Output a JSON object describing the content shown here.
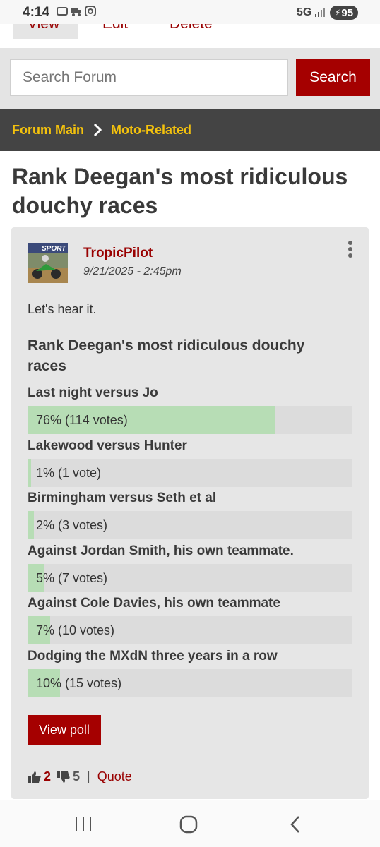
{
  "status_bar": {
    "time": "4:14",
    "network": "5G",
    "battery": "95"
  },
  "post_tabs": {
    "view": "View",
    "edit": "Edit",
    "delete": "Delete"
  },
  "search": {
    "placeholder": "Search Forum",
    "button_label": "Search"
  },
  "breadcrumb": {
    "items": [
      "Forum Main",
      "Moto-Related"
    ]
  },
  "thread": {
    "title": "Rank Deegan's most ridiculous douchy races"
  },
  "post": {
    "author": "TropicPilot",
    "date": "9/21/2025 - 2:45pm",
    "body": "Let's hear it.",
    "avatar_text": "SPORT",
    "likes": "2",
    "dislikes": "5",
    "divider": "|",
    "quote_label": "Quote"
  },
  "poll": {
    "question": "Rank Deegan's most ridiculous douchy races",
    "options": [
      {
        "label": "Last night versus Jo",
        "result": "76% (114 votes)",
        "percent": 76
      },
      {
        "label": "Lakewood versus Hunter",
        "result": "1% (1 vote)",
        "percent": 1
      },
      {
        "label": "Birmingham versus Seth et al",
        "result": "2% (3 votes)",
        "percent": 2
      },
      {
        "label": "Against Jordan Smith, his own teammate.",
        "result": "5% (7 votes)",
        "percent": 5
      },
      {
        "label": "Against Cole Davies, his own teammate",
        "result": "7% (10 votes)",
        "percent": 7
      },
      {
        "label": "Dodging the MXdN three years in a row",
        "result": "10% (15 votes)",
        "percent": 10
      }
    ],
    "view_poll_label": "View poll"
  },
  "colors": {
    "accent": "#a50000",
    "link": "#990000",
    "breadcrumb_bg": "#444444",
    "breadcrumb_text": "#f4c20d",
    "poll_fill": "#b7ddb5",
    "poll_track": "#dcdcdc"
  },
  "icons": [
    "chevron-right-icon",
    "more-vertical-icon",
    "thumbs-up-icon",
    "thumbs-down-icon",
    "recent-apps-icon",
    "home-icon",
    "back-icon"
  ]
}
